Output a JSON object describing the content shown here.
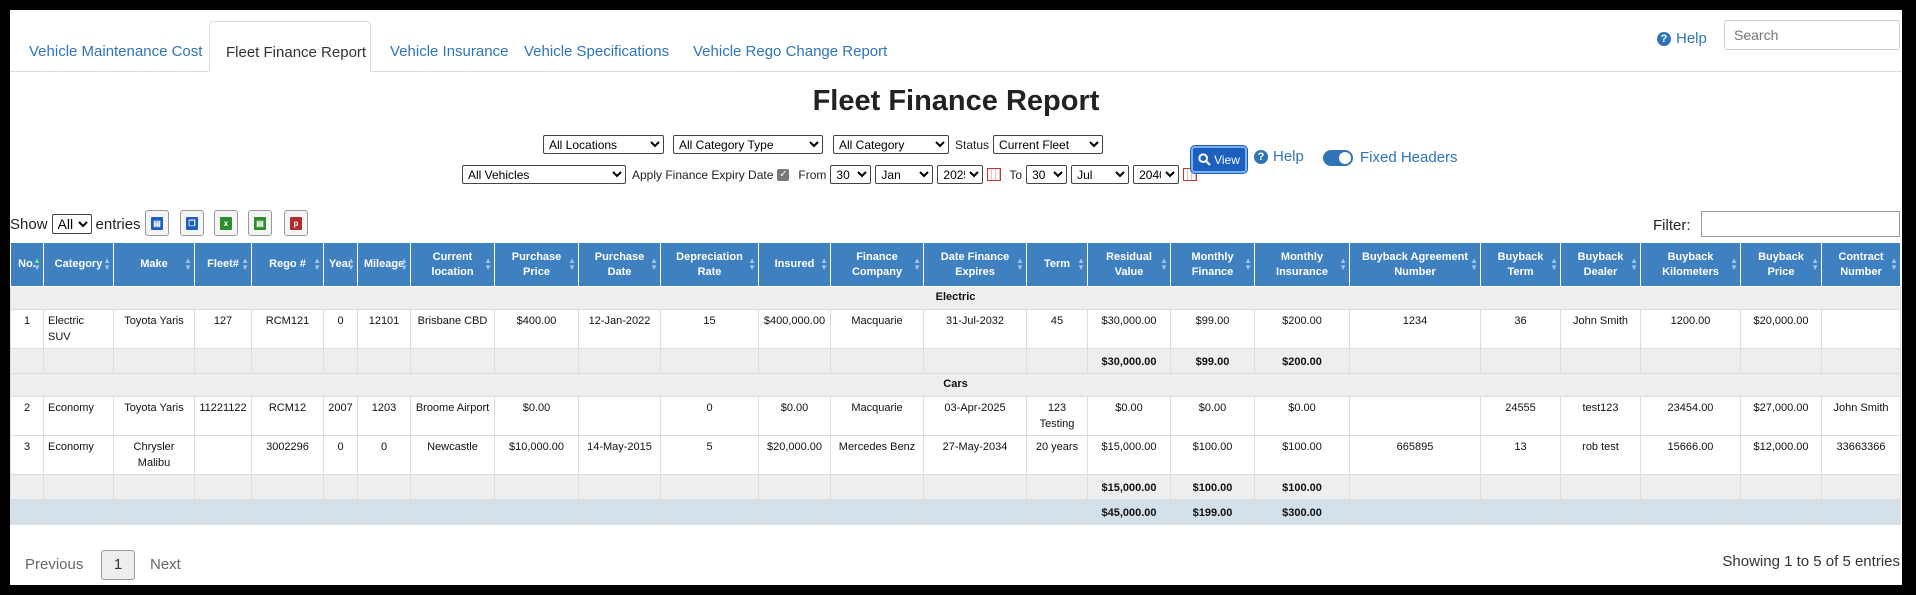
{
  "tabs": [
    {
      "label": "Vehicle Maintenance Cost",
      "active": false
    },
    {
      "label": "Fleet Finance Report",
      "active": true
    },
    {
      "label": "Vehicle Insurance",
      "active": false
    },
    {
      "label": "Vehicle Specifications",
      "active": false
    },
    {
      "label": "Vehicle Rego Change Report",
      "active": false
    }
  ],
  "header": {
    "help_label": "Help",
    "search_placeholder": "Search"
  },
  "title": "Fleet Finance Report",
  "filters": {
    "location": "All Locations",
    "category_type": "All Category Type",
    "category": "All Category",
    "status_label": "Status",
    "status": "Current Fleet",
    "vehicles": "All Vehicles",
    "apply_label": "Apply Finance Expiry Date",
    "from_label": "From",
    "from_day": "30",
    "from_month": "Jan",
    "from_year": "2025",
    "to_label": "To",
    "to_day": "30",
    "to_month": "Jul",
    "to_year": "2040",
    "view_label": "View",
    "help_label": "Help",
    "fixed_headers_label": "Fixed Headers"
  },
  "table_controls": {
    "show_label": "Show",
    "show_value": "All",
    "entries_label": "entries",
    "filter_label": "Filter:"
  },
  "columns": [
    "No.",
    "Category",
    "Make",
    "Fleet#",
    "Rego #",
    "Year",
    "Mileage",
    "Current location",
    "Purchase Price",
    "Purchase Date",
    "Depreciation Rate",
    "Insured",
    "Finance Company",
    "Date Finance Expires",
    "Term",
    "Residual Value",
    "Monthly Finance",
    "Monthly Insurance",
    "Buyback Agreement Number",
    "Buyback Term",
    "Buyback Dealer",
    "Buyback Kilometers",
    "Buyback Price",
    "Contract Number"
  ],
  "groups": [
    {
      "name": "Electric",
      "rows": [
        [
          "1",
          "Electric SUV",
          "Toyota Yaris",
          "127",
          "RCM121",
          "0",
          "12101",
          "Brisbane CBD",
          "$400.00",
          "12-Jan-2022",
          "15",
          "$400,000.00",
          "Macquarie",
          "31-Jul-2032",
          "45",
          "$30,000.00",
          "$99.00",
          "$200.00",
          "1234",
          "36",
          "John Smith",
          "1200.00",
          "$20,000.00",
          ""
        ]
      ],
      "subtotal": {
        "residual": "$30,000.00",
        "monthly_finance": "$99.00",
        "monthly_insurance": "$200.00"
      }
    },
    {
      "name": "Cars",
      "rows": [
        [
          "2",
          "Economy",
          "Toyota Yaris",
          "11221122",
          "RCM12",
          "2007",
          "1203",
          "Broome Airport",
          "$0.00",
          "",
          "0",
          "$0.00",
          "Macquarie",
          "03-Apr-2025",
          "123 Testing",
          "$0.00",
          "$0.00",
          "$0.00",
          "",
          "24555",
          "test123",
          "23454.00",
          "$27,000.00",
          "John Smith"
        ],
        [
          "3",
          "Economy",
          "Chrysler Malibu",
          "",
          "3002296",
          "0",
          "0",
          "Newcastle",
          "$10,000.00",
          "14-May-2015",
          "5",
          "$20,000.00",
          "Mercedes Benz",
          "27-May-2034",
          "20 years",
          "$15,000.00",
          "$100.00",
          "$100.00",
          "665895",
          "13",
          "rob test",
          "15666.00",
          "$12,000.00",
          "33663366"
        ]
      ],
      "subtotal": {
        "residual": "$15,000.00",
        "monthly_finance": "$100.00",
        "monthly_insurance": "$100.00"
      }
    }
  ],
  "grand_total": {
    "residual": "$45,000.00",
    "monthly_finance": "$199.00",
    "monthly_insurance": "$300.00"
  },
  "pagination": {
    "previous": "Previous",
    "page": "1",
    "next": "Next",
    "info": "Showing 1 to 5 of 5 entries"
  }
}
